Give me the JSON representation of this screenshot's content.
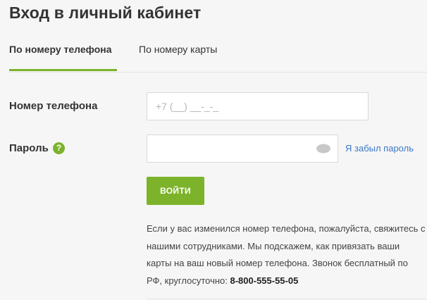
{
  "page": {
    "title": "Вход в личный кабинет"
  },
  "tabs": [
    {
      "label": "По номеру телефона",
      "active": true
    },
    {
      "label": "По номеру карты",
      "active": false
    }
  ],
  "form": {
    "phone": {
      "label": "Номер телефона",
      "placeholder": "+7 (__) __-_-_",
      "value": ""
    },
    "password": {
      "label": "Пароль",
      "help_icon": "question-mark",
      "eye_icon": "eye-icon",
      "value": "",
      "forgot_link": "Я забыл пароль"
    },
    "submit_label": "ВОЙТИ"
  },
  "info": {
    "text": "Если у вас изменился номер телефона, пожалуйста, свяжитесь с нашими сотрудниками. Мы подскажем, как привязать ваши карты на ваш новый номер телефона. Звонок бесплатный по РФ, круглосуточно: ",
    "phone_number": "8-800-555-55-05"
  },
  "colors": {
    "accent": "#7cb32b",
    "link": "#3c78c8",
    "background": "#f6f6f6",
    "text": "#333333"
  }
}
